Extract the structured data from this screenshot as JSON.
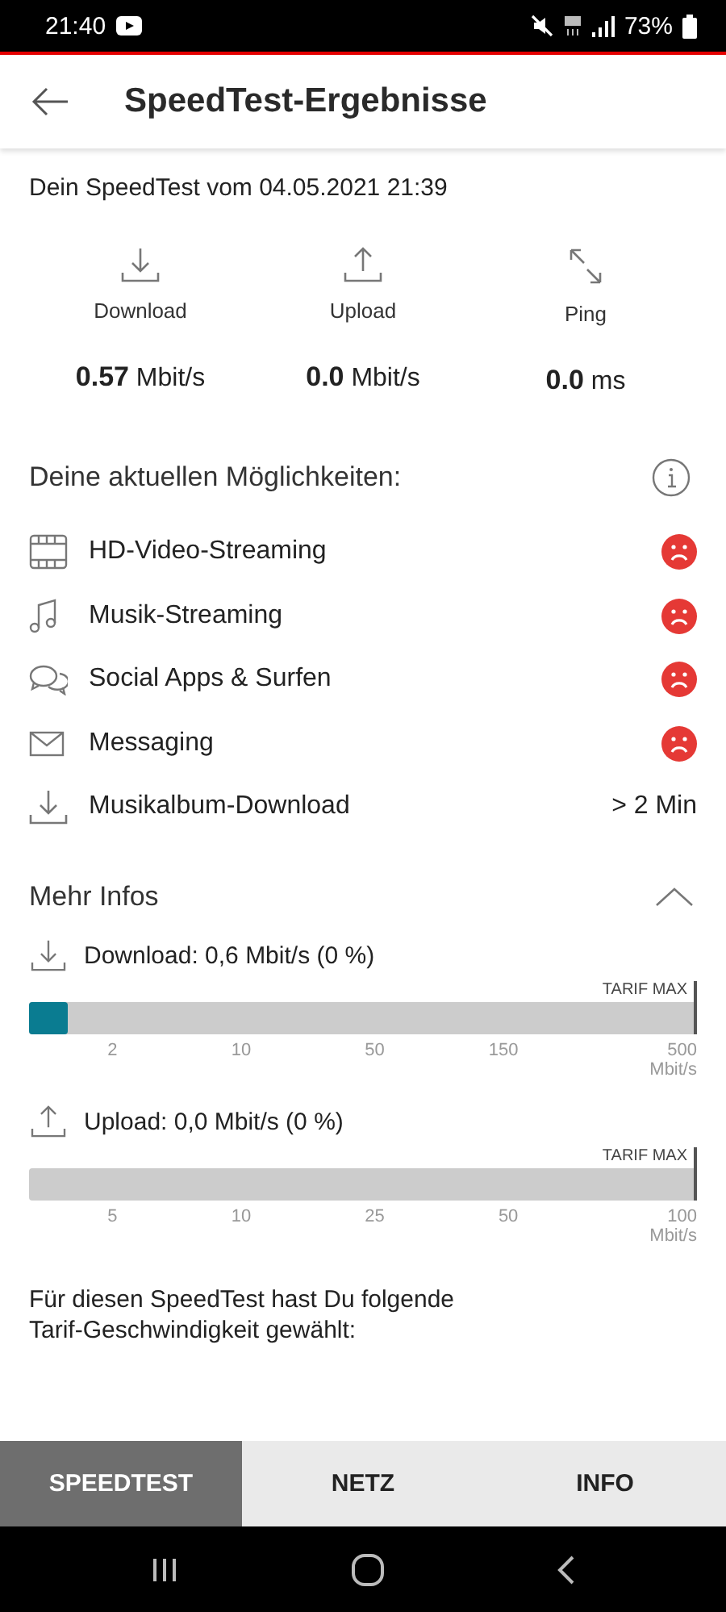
{
  "status_bar": {
    "time": "21:40",
    "battery": "73%"
  },
  "header": {
    "title": "SpeedTest-Ergebnisse"
  },
  "test_date": "Dein SpeedTest vom 04.05.2021 21:39",
  "stats": [
    {
      "kind": "download",
      "label": "Download",
      "value": "0.57",
      "unit": "Mbit/s"
    },
    {
      "kind": "upload",
      "label": "Upload",
      "value": "0.0",
      "unit": "Mbit/s"
    },
    {
      "kind": "ping",
      "label": "Ping",
      "value": "0.0",
      "unit": "ms"
    }
  ],
  "possibilities": {
    "title": "Deine aktuellen Möglichkeiten:",
    "items": [
      {
        "label": "HD-Video-Streaming",
        "kind": "sad"
      },
      {
        "label": "Musik-Streaming",
        "kind": "sad"
      },
      {
        "label": "Social Apps & Surfen",
        "kind": "sad"
      },
      {
        "label": "Messaging",
        "kind": "sad"
      },
      {
        "label": "Musikalbum-Download",
        "kind": "value",
        "value": "> 2 Min"
      }
    ]
  },
  "more_info": {
    "title": "Mehr Infos",
    "expanded": true,
    "bars": [
      {
        "kind": "download",
        "label": "Download: 0,6 Mbit/s (0 %)",
        "max_label": "TARIF MAX",
        "level": 0.058,
        "ticks": [
          "2",
          "10",
          "50",
          "150",
          "500"
        ],
        "unit": "Mbit/s"
      },
      {
        "kind": "upload",
        "label": "Upload: 0,0 Mbit/s (0 %)",
        "max_label": "TARIF MAX",
        "ticks": [
          "5",
          "10",
          "25",
          "50",
          "100"
        ],
        "unit": "Mbit/s"
      }
    ]
  },
  "tariff_note": "Für diesen SpeedTest hast Du folgende Tarif-Geschwindigkeit gewählt:",
  "tabs": [
    {
      "label": "SPEEDTEST",
      "selected": true
    },
    {
      "label": "NETZ",
      "selected": false
    },
    {
      "label": "INFO",
      "selected": false
    }
  ]
}
